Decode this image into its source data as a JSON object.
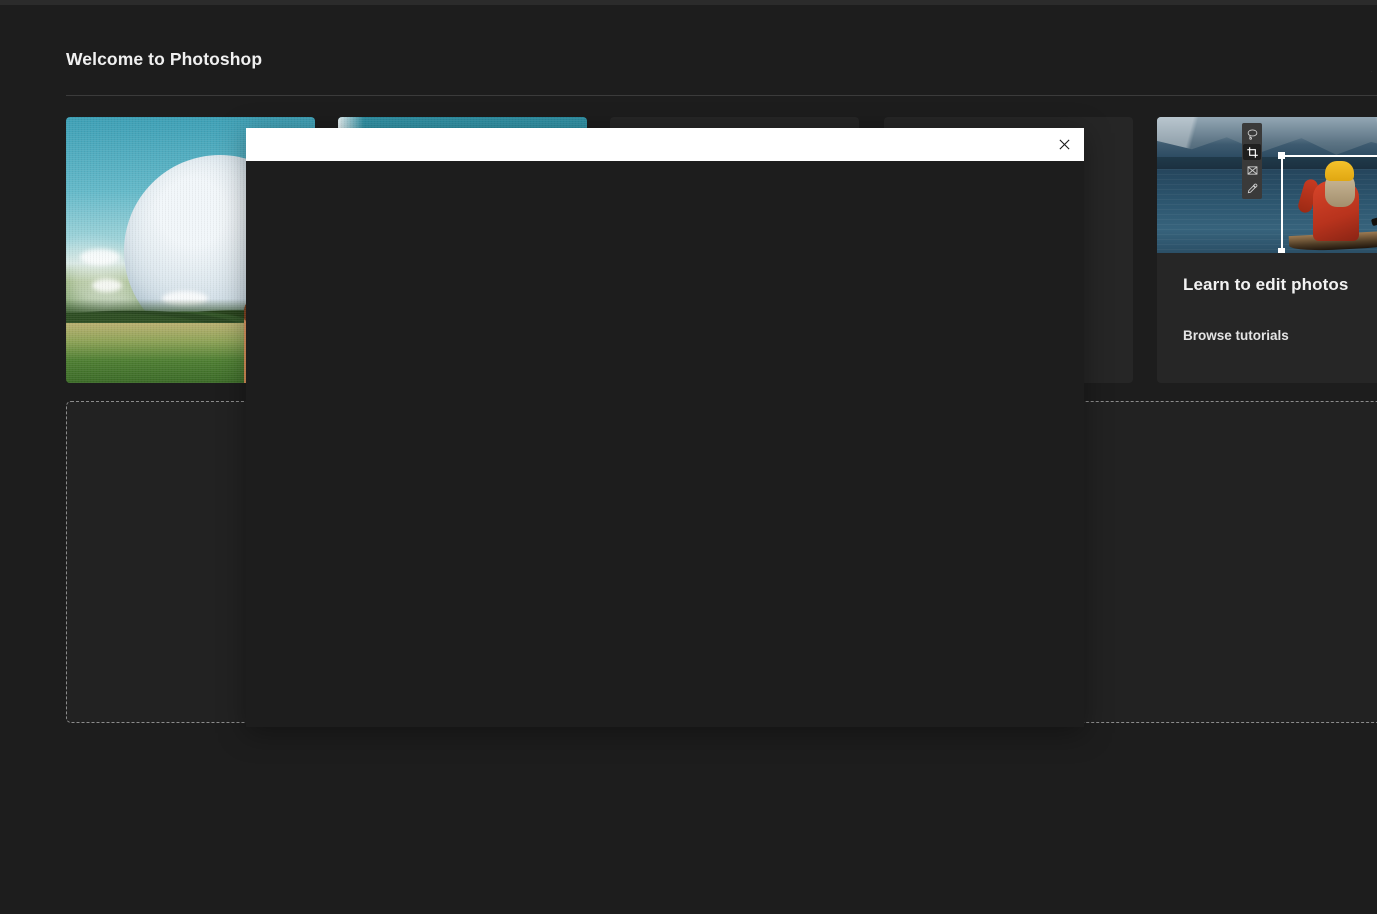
{
  "window": {
    "top_strip_color": "#2b2b2b"
  },
  "header": {
    "title": "Welcome to Photoshop",
    "right_edge_glyph": "▲"
  },
  "cards": [
    {
      "artwork": "giraffe-moon-surreal-composite",
      "heading": "",
      "link": "",
      "obscured_by_dialog": false
    },
    {
      "artwork": "teal-sky-gradient",
      "heading": "",
      "link": "",
      "obscured_by_dialog": true
    },
    {
      "artwork": "hidden-behind-dialog",
      "heading": "",
      "link": "",
      "obscured_by_dialog": true
    },
    {
      "artwork": "hidden-behind-dialog",
      "heading": "",
      "link": "",
      "obscured_by_dialog": true
    },
    {
      "artwork": "lake-canoe-photo",
      "heading": "Learn to edit photos",
      "link": "Browse tutorials",
      "obscured_by_dialog": false
    }
  ],
  "tool_palette": {
    "tools": [
      {
        "name": "lasso-tool",
        "selected": false
      },
      {
        "name": "crop-tool",
        "selected": true
      },
      {
        "name": "transform-tool",
        "selected": false
      },
      {
        "name": "eyedropper-tool",
        "selected": false
      }
    ]
  },
  "drop_zone": {
    "label": ""
  },
  "dialog": {
    "title": "",
    "close_label": "✕",
    "body_text": ""
  },
  "colors": {
    "app_background": "#1d1d1d",
    "card_background": "#262626",
    "dialog_titlebar": "#ffffff",
    "dialog_body": "#1d1d1d",
    "divider": "#3b3b3b",
    "drop_zone_border": "#8c8c8c",
    "text_primary": "#f0f0f0"
  }
}
